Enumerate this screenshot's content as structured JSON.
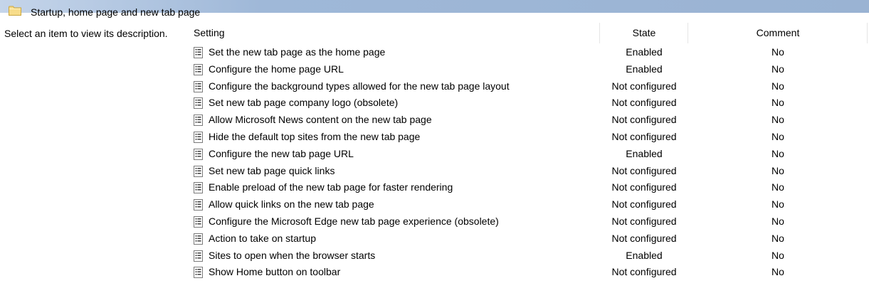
{
  "header": {
    "title": "Startup, home page and new tab page",
    "icon": "folder-icon"
  },
  "description_pane": {
    "text": "Select an item to view its description."
  },
  "columns": {
    "setting": "Setting",
    "state": "State",
    "comment": "Comment"
  },
  "rows": [
    {
      "name": "Set the new tab page as the home page",
      "state": "Enabled",
      "comment": "No"
    },
    {
      "name": "Configure the home page URL",
      "state": "Enabled",
      "comment": "No"
    },
    {
      "name": "Configure the background types allowed for the new tab page layout",
      "state": "Not configured",
      "comment": "No"
    },
    {
      "name": "Set new tab page company logo (obsolete)",
      "state": "Not configured",
      "comment": "No"
    },
    {
      "name": "Allow Microsoft News content on the new tab page",
      "state": "Not configured",
      "comment": "No"
    },
    {
      "name": "Hide the default top sites from the new tab page",
      "state": "Not configured",
      "comment": "No"
    },
    {
      "name": "Configure the new tab page URL",
      "state": "Enabled",
      "comment": "No"
    },
    {
      "name": "Set new tab page quick links",
      "state": "Not configured",
      "comment": "No"
    },
    {
      "name": "Enable preload of the new tab page for faster rendering",
      "state": "Not configured",
      "comment": "No"
    },
    {
      "name": "Allow quick links on the new tab page",
      "state": "Not configured",
      "comment": "No"
    },
    {
      "name": "Configure the Microsoft Edge new tab page experience (obsolete)",
      "state": "Not configured",
      "comment": "No"
    },
    {
      "name": "Action to take on startup",
      "state": "Not configured",
      "comment": "No"
    },
    {
      "name": "Sites to open when the browser starts",
      "state": "Enabled",
      "comment": "No"
    },
    {
      "name": "Show Home button on toolbar",
      "state": "Not configured",
      "comment": "No"
    }
  ],
  "colors": {
    "header_band": "#9ab3d3",
    "column_separator": "#e5e5e5",
    "folder_fill": "#f7dc8a"
  }
}
